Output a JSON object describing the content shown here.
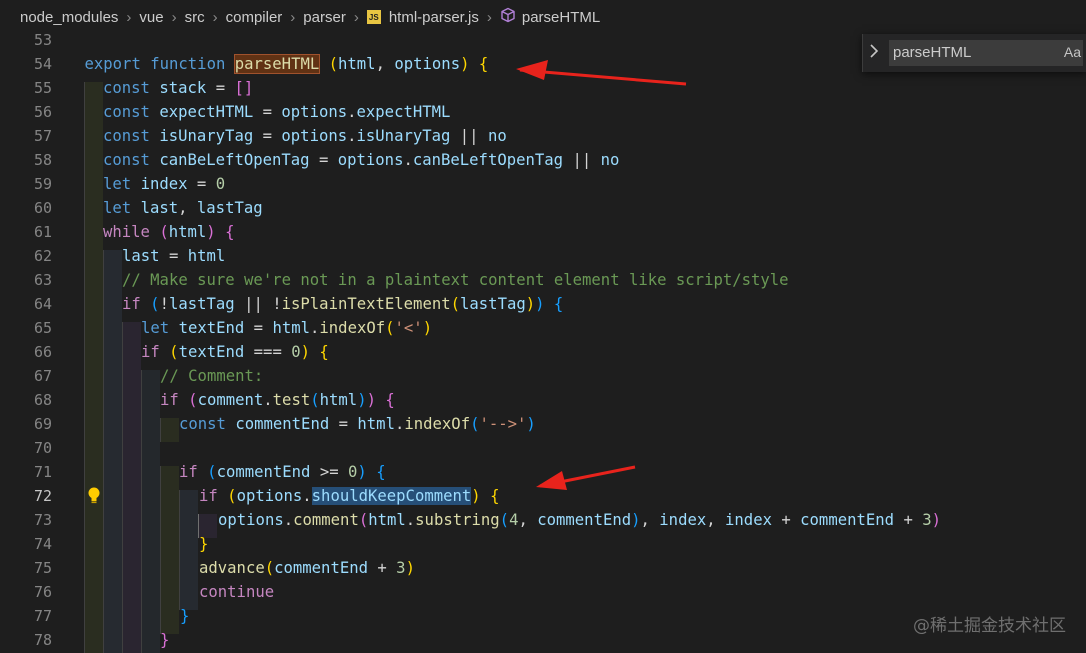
{
  "breadcrumb": {
    "items": [
      "node_modules",
      "vue",
      "src",
      "compiler",
      "parser"
    ],
    "file_badge": "JS",
    "file": "html-parser.js",
    "symbol": "parseHTML"
  },
  "find_widget": {
    "value": "parseHTML",
    "toggle_icon": "chevron-right-icon",
    "match_case_label": "Aa"
  },
  "active_line": "72",
  "line_numbers": [
    "53",
    "54",
    "55",
    "56",
    "57",
    "58",
    "59",
    "60",
    "61",
    "62",
    "63",
    "64",
    "65",
    "66",
    "67",
    "68",
    "69",
    "70",
    "71",
    "72",
    "73",
    "74",
    "75",
    "76",
    "77",
    "78"
  ],
  "code": {
    "l54": [
      "export",
      "function",
      "parseHTML",
      "(",
      "html",
      ",",
      "options",
      ")",
      "{"
    ],
    "l55": [
      "const",
      "stack",
      "=",
      "[]"
    ],
    "l56": [
      "const",
      "expectHTML",
      "=",
      "options",
      ".",
      "expectHTML"
    ],
    "l57": [
      "const",
      "isUnaryTag",
      "=",
      "options",
      ".",
      "isUnaryTag",
      "||",
      "no"
    ],
    "l58": [
      "const",
      "canBeLeftOpenTag",
      "=",
      "options",
      ".",
      "canBeLeftOpenTag",
      "||",
      "no"
    ],
    "l59": [
      "let",
      "index",
      "=",
      "0"
    ],
    "l60": [
      "let",
      "last",
      ",",
      "lastTag"
    ],
    "l61": [
      "while",
      "(",
      "html",
      ")",
      "{"
    ],
    "l62": [
      "last",
      "=",
      "html"
    ],
    "l63": [
      "// Make sure we're not in a plaintext content element like script/style"
    ],
    "l64": [
      "if",
      "(",
      "!",
      "lastTag",
      "||",
      "!",
      "isPlainTextElement",
      "(",
      "lastTag",
      ")",
      ")",
      "{"
    ],
    "l65": [
      "let",
      "textEnd",
      "=",
      "html",
      ".",
      "indexOf",
      "(",
      "'<'",
      ")"
    ],
    "l66": [
      "if",
      "(",
      "textEnd",
      "===",
      "0",
      ")",
      "{"
    ],
    "l67": [
      "// Comment:"
    ],
    "l68": [
      "if",
      "(",
      "comment",
      ".",
      "test",
      "(",
      "html",
      ")",
      ")",
      "{"
    ],
    "l69": [
      "const",
      "commentEnd",
      "=",
      "html",
      ".",
      "indexOf",
      "(",
      "'-->'",
      ")"
    ],
    "l71": [
      "if",
      "(",
      "commentEnd",
      ">=",
      "0",
      ")",
      "{"
    ],
    "l72": [
      "if",
      "(",
      "options",
      ".",
      "shouldKeepComment",
      ")",
      "{"
    ],
    "l73": [
      "options",
      ".",
      "comment",
      "(",
      "html",
      ".",
      "substring",
      "(",
      "4",
      ",",
      "commentEnd",
      ")",
      ",",
      "index",
      ",",
      "index",
      "+",
      "commentEnd",
      "+",
      "3",
      ")"
    ],
    "l74": [
      "}"
    ],
    "l75": [
      "advance",
      "(",
      "commentEnd",
      "+",
      "3",
      ")"
    ],
    "l76": [
      "continue"
    ],
    "l77": [
      "}"
    ],
    "l78": [
      "}"
    ]
  },
  "watermark": "@稀土掘金技术社区",
  "colors": {
    "background": "#1e1e1e",
    "keyword": "#569cd6",
    "control": "#c586c0",
    "variable": "#9cdcfe",
    "function": "#dcdcaa",
    "number": "#b5cea8",
    "string": "#ce9178",
    "comment": "#6a9955",
    "find_match": "#613214",
    "selection": "#264f78",
    "annotation_arrow": "#e8231c"
  }
}
